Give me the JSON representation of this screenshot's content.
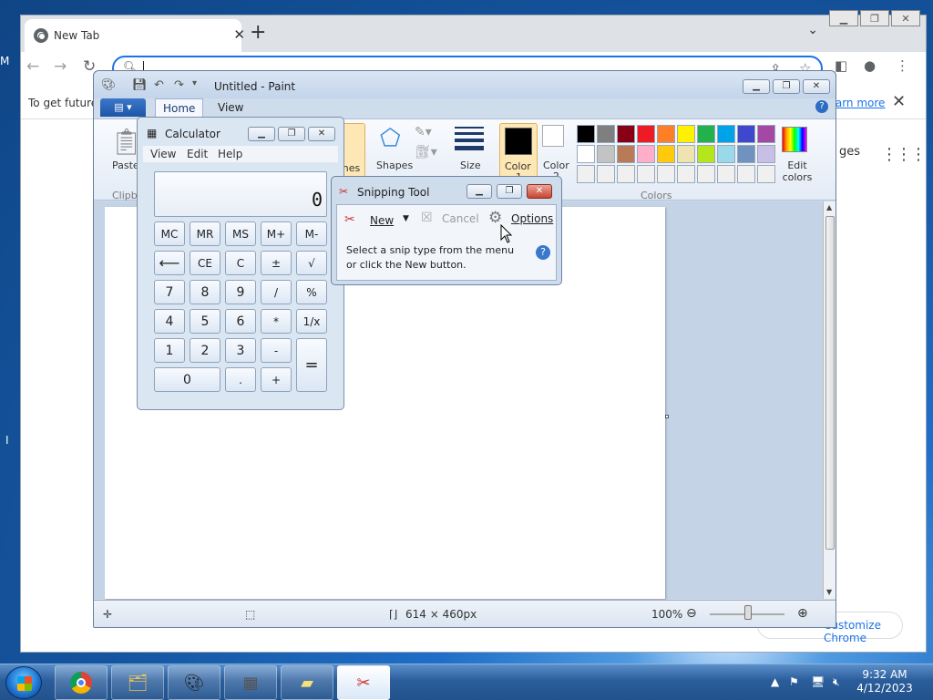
{
  "desktop": {
    "left_letter": "M",
    "left_letter2": "I"
  },
  "chrome": {
    "tab_title": "New Tab",
    "tab_close": "✕",
    "new_tab": "+",
    "tab_menu": "⌄",
    "infobar_text": "To get future",
    "infobar_link": "Learn more",
    "infobar_close": "✕",
    "ntp_partial": "ges",
    "ntp_apps": "⋮⋮⋮",
    "customize_label": "Customize Chrome"
  },
  "paint": {
    "title": "Untitled - Paint",
    "tabs": [
      "Home",
      "View"
    ],
    "ribbon": {
      "paste": "Paste",
      "clipboard_group": "Clipb",
      "brushes": "shes",
      "shapes": "Shapes",
      "size": "Size",
      "color1": "Color",
      "color1_num": "1",
      "color2": "Color",
      "color2_num": "2",
      "edit_colors": "Edit colors",
      "colors_group": "Colors"
    },
    "palette": [
      "#000000",
      "#7f7f7f",
      "#880015",
      "#ed1c24",
      "#ff7f27",
      "#fff200",
      "#22b14c",
      "#00a2e8",
      "#3f48cc",
      "#a349a4",
      "#ffffff",
      "#c3c3c3",
      "#b97a57",
      "#ffaec9",
      "#ffc90e",
      "#efe4b0",
      "#b5e61d",
      "#99d9ea",
      "#7092be",
      "#c8bfe7",
      "#f0f0f0",
      "#f0f0f0",
      "#f0f0f0",
      "#f0f0f0",
      "#f0f0f0",
      "#f0f0f0",
      "#f0f0f0",
      "#f0f0f0",
      "#f0f0f0",
      "#f0f0f0"
    ],
    "status": {
      "canvas_size": "614 × 460px",
      "zoom": "100%"
    }
  },
  "calculator": {
    "title": "Calculator",
    "menu": [
      "View",
      "Edit",
      "Help"
    ],
    "display": "0",
    "buttons": {
      "mc": "MC",
      "mr": "MR",
      "ms": "MS",
      "mplus": "M+",
      "mminus": "M-",
      "back": "⟵",
      "ce": "CE",
      "c": "C",
      "pm": "±",
      "sqrt": "√",
      "n7": "7",
      "n8": "8",
      "n9": "9",
      "div": "/",
      "pct": "%",
      "n4": "4",
      "n5": "5",
      "n6": "6",
      "mul": "*",
      "inv": "1/x",
      "n1": "1",
      "n2": "2",
      "n3": "3",
      "sub": "-",
      "eq": "=",
      "n0": "0",
      "dot": ".",
      "add": "+"
    }
  },
  "snipping": {
    "title": "Snipping Tool",
    "new_label": "New",
    "cancel_label": "Cancel",
    "options_label": "Options",
    "message_line1": "Select a snip type from the menu",
    "message_line2": "or click the New button."
  },
  "taskbar": {
    "time": "9:32 AM",
    "date": "4/12/2023"
  }
}
